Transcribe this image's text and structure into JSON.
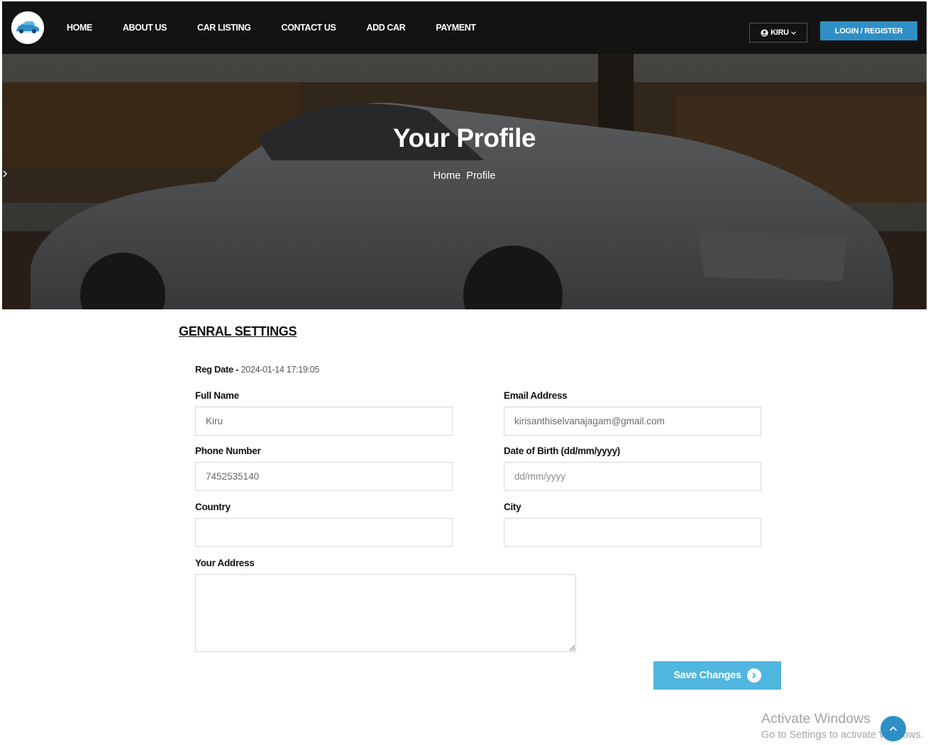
{
  "header": {
    "logo_icon": "car-logo-icon",
    "nav": [
      {
        "label": "HOME"
      },
      {
        "label": "ABOUT US"
      },
      {
        "label": "CAR LISTING"
      },
      {
        "label": "CONTACT US"
      },
      {
        "label": "ADD CAR"
      },
      {
        "label": "PAYMENT"
      }
    ],
    "user_label": "KIRU",
    "user_icon": "user-circle-icon",
    "login_label": "LOGIN / REGISTER"
  },
  "hero": {
    "title": "Your Profile",
    "breadcrumb": [
      "Home",
      "Profile"
    ]
  },
  "settings": {
    "title": "GENRAL SETTINGS",
    "reg_date_label": "Reg Date -",
    "reg_date_value": "2024-01-14 17:19:05",
    "fields": {
      "full_name": {
        "label": "Full Name",
        "value": "Kiru",
        "placeholder": ""
      },
      "email": {
        "label": "Email Address",
        "value": "kirisanthiselvanajagam@gmail.com",
        "placeholder": ""
      },
      "phone": {
        "label": "Phone Number",
        "value": "7452535140",
        "placeholder": ""
      },
      "dob": {
        "label": "Date of Birth (dd/mm/yyyy)",
        "value": "",
        "placeholder": "dd/mm/yyyy"
      },
      "country": {
        "label": "Country",
        "value": "",
        "placeholder": ""
      },
      "city": {
        "label": "City",
        "value": "",
        "placeholder": ""
      },
      "address": {
        "label": "Your Address",
        "value": ""
      }
    },
    "save_label": "Save Changes"
  },
  "watermark": {
    "line1": "Activate Windows",
    "line2": "Go to Settings to activate Windows."
  },
  "colors": {
    "topbar": "#131313",
    "accent_blue": "#2f8fc4",
    "save_button": "#50b6df"
  }
}
